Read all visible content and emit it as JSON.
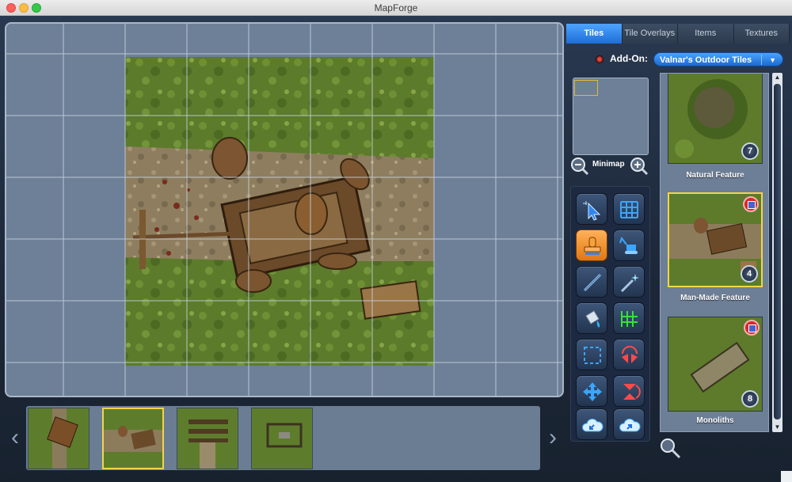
{
  "window": {
    "title": "MapForge"
  },
  "tabs": [
    {
      "label": "Tiles",
      "active": true
    },
    {
      "label": "Tile Overlays",
      "active": false
    },
    {
      "label": "Items",
      "active": false
    },
    {
      "label": "Textures",
      "active": false
    }
  ],
  "addon": {
    "label": "Add-On:",
    "selected": "Valnar's Outdoor Tiles"
  },
  "minimap": {
    "label": "Minimap"
  },
  "tools": [
    {
      "name": "select-tool",
      "icon": "cursor-icon"
    },
    {
      "name": "grid-tool",
      "icon": "grid-icon"
    },
    {
      "name": "stamp-tool",
      "icon": "stamp-icon",
      "active": true
    },
    {
      "name": "excavator-tool",
      "icon": "excavator-icon"
    },
    {
      "name": "line-tool",
      "icon": "pencil-icon"
    },
    {
      "name": "magic-wand-tool",
      "icon": "magic-wand-icon"
    },
    {
      "name": "fill-tool",
      "icon": "paint-bucket-icon"
    },
    {
      "name": "grid-fill-tool",
      "icon": "grid-fill-icon"
    },
    {
      "name": "selection-tool",
      "icon": "marquee-icon"
    },
    {
      "name": "flip-horizontal-tool",
      "icon": "flip-horizontal-icon"
    },
    {
      "name": "move-tool",
      "icon": "move-arrows-icon"
    },
    {
      "name": "flip-vertical-tool",
      "icon": "flip-vertical-icon"
    },
    {
      "name": "cloud-import-tool",
      "icon": "cloud-import-icon"
    },
    {
      "name": "cloud-export-tool",
      "icon": "cloud-export-icon"
    }
  ],
  "library": {
    "tiles": [
      {
        "label": "Natural Feature",
        "count": "7",
        "selected": false,
        "addon_badge": false
      },
      {
        "label": "Man-Made Feature",
        "count": "4",
        "selected": true,
        "addon_badge": true
      },
      {
        "label": "Monoliths",
        "count": "8",
        "selected": false,
        "addon_badge": true
      }
    ]
  },
  "strip": {
    "thumbnails": [
      {
        "name": "cart-wreck-thumb",
        "selected": false
      },
      {
        "name": "broken-wagon-thumb",
        "selected": true
      },
      {
        "name": "fence-road-thumb",
        "selected": false
      },
      {
        "name": "stone-ruin-thumb",
        "selected": false
      }
    ]
  },
  "colors": {
    "accent": "#2f86f0",
    "selection": "#f1d54a",
    "grass": "#5d7d2c",
    "dirt_road": "#8f7d5e"
  }
}
